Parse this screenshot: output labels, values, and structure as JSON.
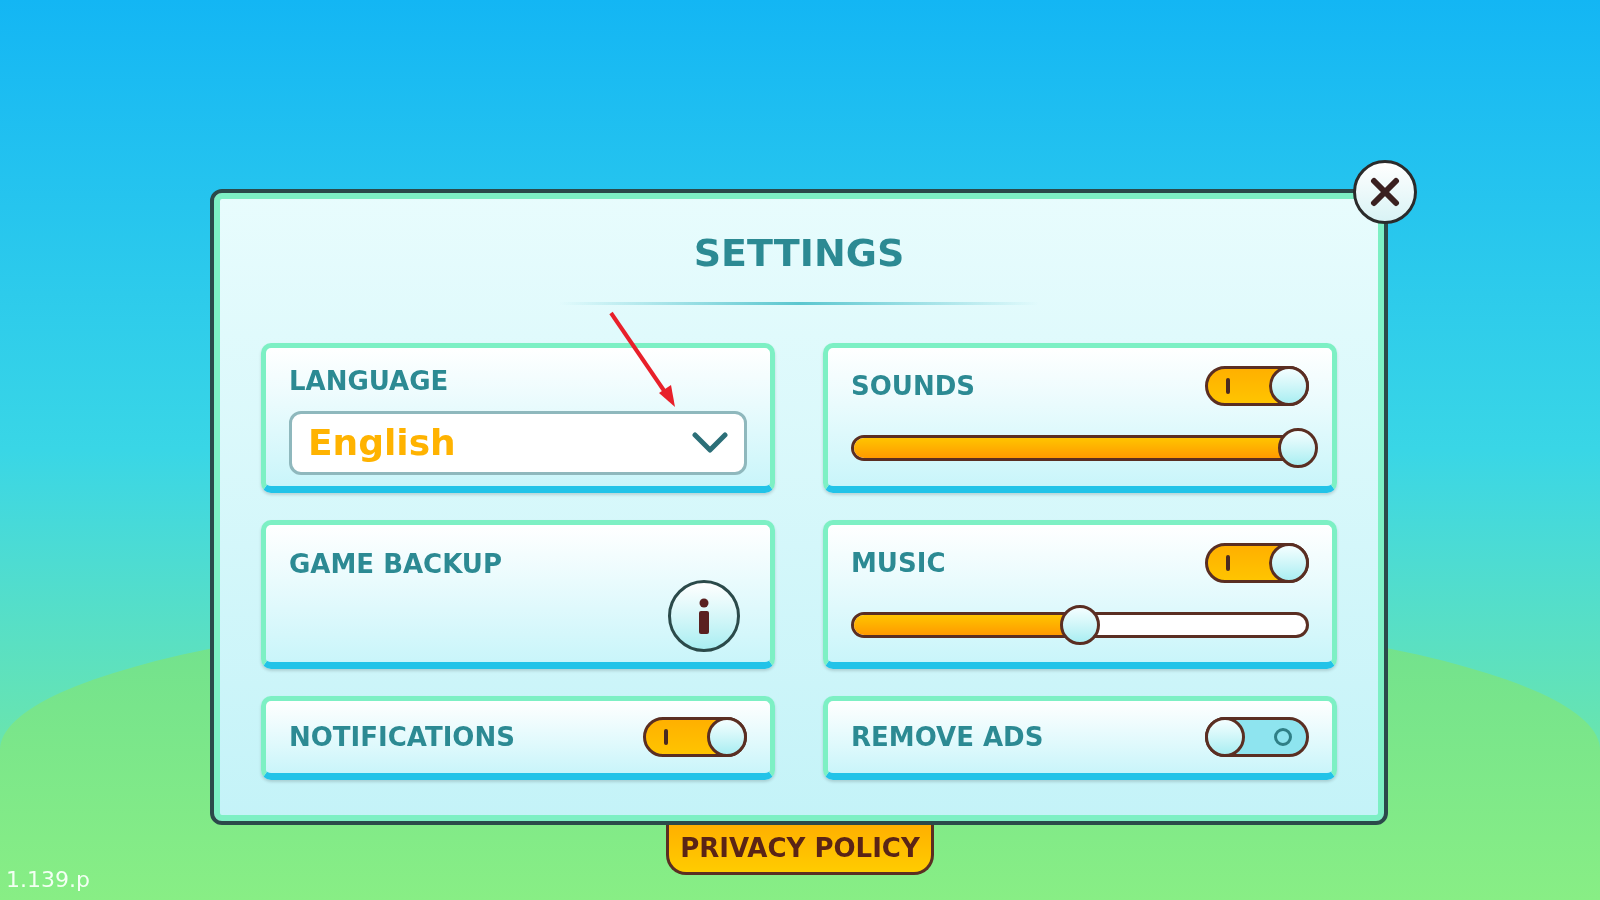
{
  "title": "SETTINGS",
  "language": {
    "label": "LANGUAGE",
    "value": "English"
  },
  "game_backup": {
    "label": "GAME BACKUP"
  },
  "notifications": {
    "label": "NOTIFICATIONS",
    "on": true
  },
  "sounds": {
    "label": "SOUNDS",
    "on": true,
    "level": 1
  },
  "music": {
    "label": "MUSIC",
    "on": true,
    "level": 0.5
  },
  "remove_ads": {
    "label": "REMOVE ADS",
    "on": false
  },
  "privacy_policy": "PRIVACY POLICY",
  "version": "1.139.p"
}
